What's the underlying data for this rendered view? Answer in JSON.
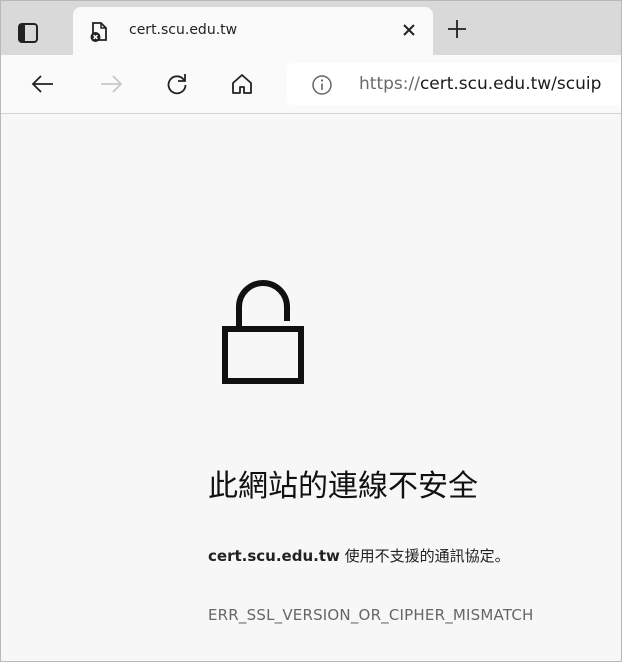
{
  "tab": {
    "title": "cert.scu.edu.tw"
  },
  "address_bar": {
    "url_prefix": "https://",
    "url_main": "cert.scu.edu.tw/scuip"
  },
  "icons": {
    "tab_actions": "tab-actions-icon",
    "favicon": "page-error-icon",
    "close": "close-icon",
    "new_tab": "plus-icon",
    "back": "back-arrow-icon",
    "forward": "forward-arrow-icon",
    "refresh": "refresh-icon",
    "home": "home-icon",
    "site_info": "info-icon",
    "lock": "unlocked-padlock-icon"
  },
  "error_page": {
    "headline": "此網站的連線不安全",
    "domain": "cert.scu.edu.tw",
    "message": " 使用不支援的通訊協定。",
    "error_code": "ERR_SSL_VERSION_OR_CIPHER_MISMATCH"
  }
}
